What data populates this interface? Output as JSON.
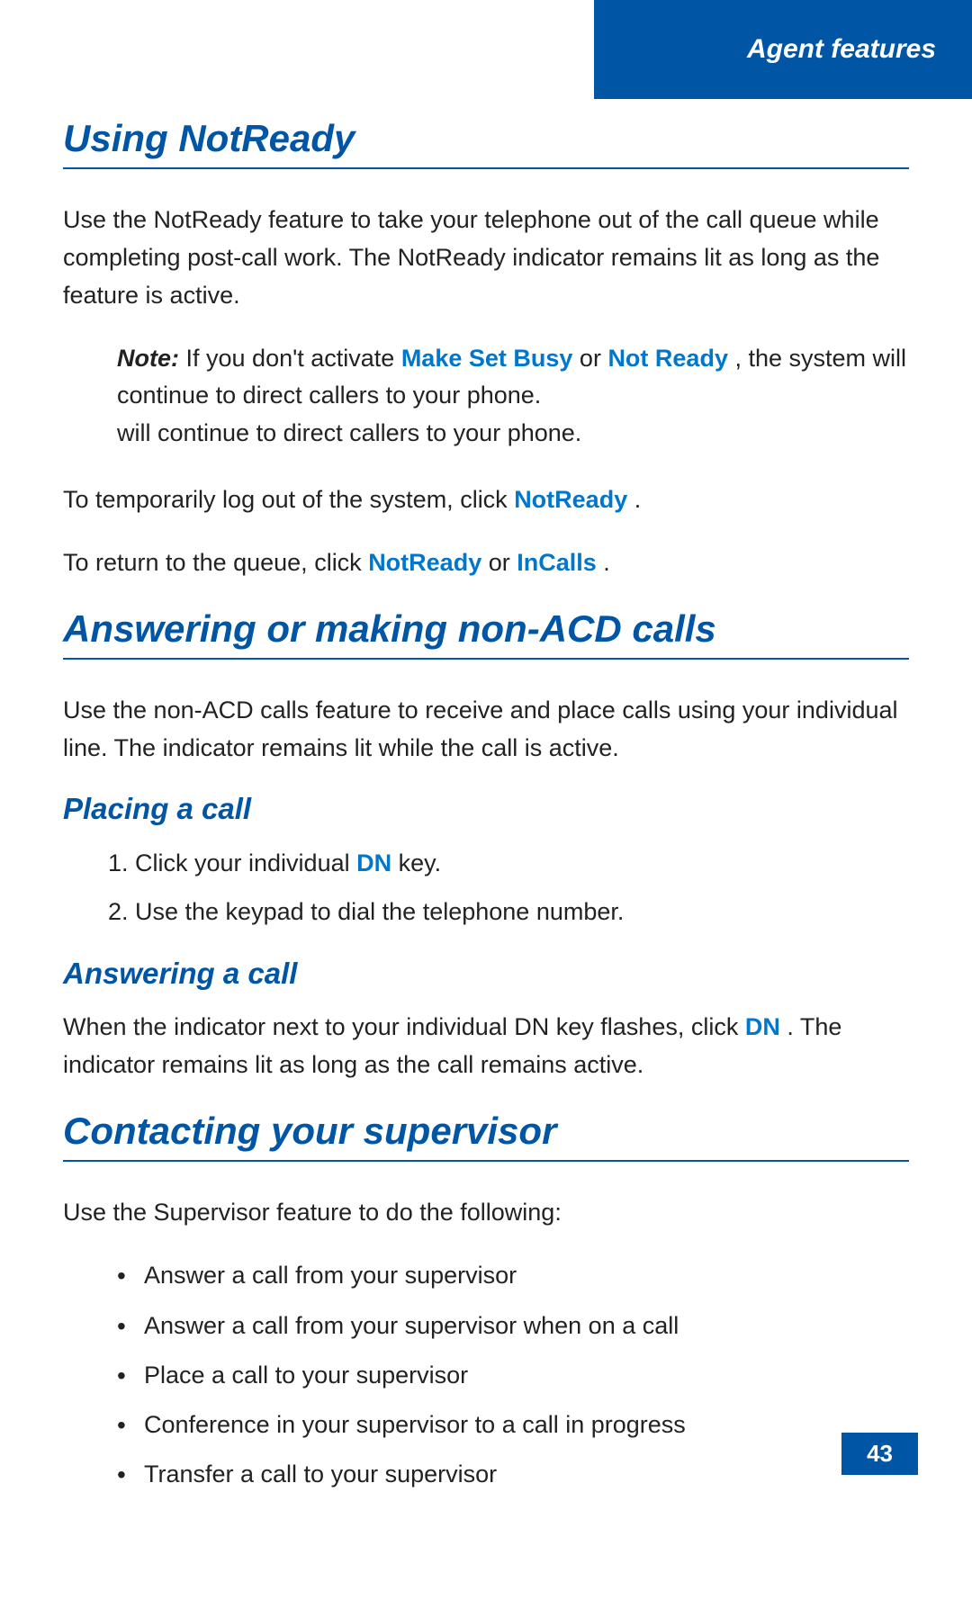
{
  "header": {
    "title": "Agent features",
    "background": "#0055a5"
  },
  "sections": {
    "using_notready": {
      "title": "Using NotReady",
      "body1": "Use the NotReady feature to take your telephone out of the call queue while completing post-call work. The NotReady indicator remains lit as long as the feature is active.",
      "note": {
        "prefix": "Note:",
        "text1": " If you don't activate ",
        "link1": "Make Set Busy",
        "text2": " or ",
        "link2": "Not Ready",
        "text3": ", the system will continue to direct callers to your phone."
      },
      "body2_prefix": "To temporarily log out of the system, click ",
      "body2_link": "NotReady",
      "body2_suffix": ".",
      "body3_prefix": "To return to the queue, click ",
      "body3_link1": "NotReady",
      "body3_middle": " or ",
      "body3_link2": "InCalls",
      "body3_suffix": "."
    },
    "answering_non_acd": {
      "title": "Answering or making non-ACD calls",
      "body1": "Use the non-ACD calls feature to receive and place calls using your individual line. The indicator remains lit while the call is active.",
      "placing_a_call": {
        "title": "Placing a call",
        "steps": [
          {
            "prefix": "Click your individual ",
            "link": "DN",
            "suffix": " key."
          },
          {
            "prefix": "Use the keypad to dial the telephone number.",
            "link": "",
            "suffix": ""
          }
        ]
      },
      "answering_a_call": {
        "title": "Answering a call",
        "body_prefix": "When the indicator next to your individual DN key flashes, click ",
        "body_link": "DN",
        "body_suffix": ". The indicator remains lit as long as the call remains active."
      }
    },
    "contacting_supervisor": {
      "title": "Contacting your supervisor",
      "body1": "Use the Supervisor feature to do the following:",
      "bullet_list": [
        "Answer a call from your supervisor",
        "Answer a call from your supervisor when on a call",
        "Place a call to your supervisor",
        "Conference in your supervisor to a call in progress",
        "Transfer a call to your supervisor"
      ]
    }
  },
  "footer": {
    "page_number": "43"
  }
}
